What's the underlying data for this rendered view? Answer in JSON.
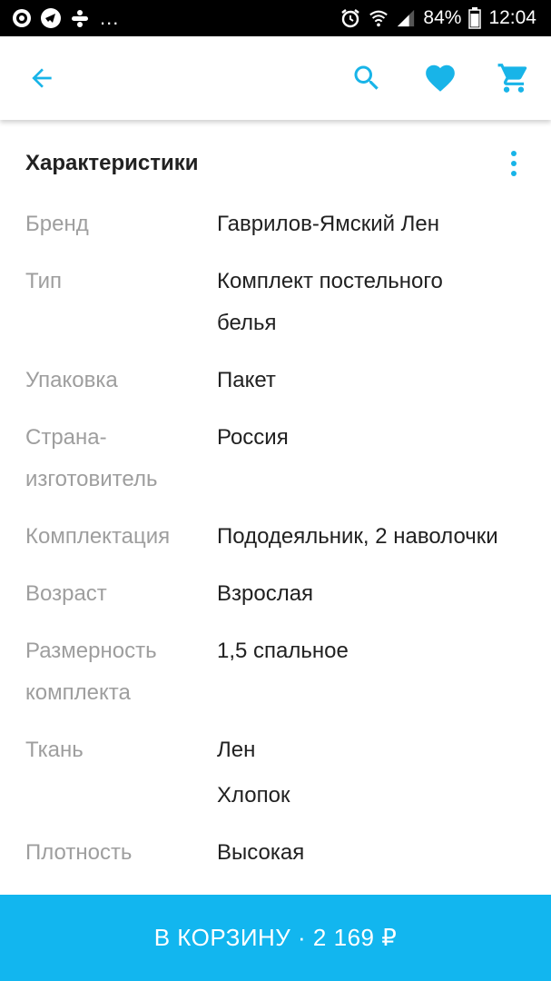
{
  "status": {
    "battery": "84%",
    "time": "12:04",
    "more": "..."
  },
  "colors": {
    "accent": "#18b4e8",
    "button": "#12b6ef"
  },
  "toolbar": {
    "icons": [
      "arrow-back-icon",
      "search-icon",
      "heart-icon",
      "shopping-cart-icon"
    ]
  },
  "section": {
    "title": "Характеристики"
  },
  "specs": [
    {
      "label": "Бренд",
      "values": [
        "Гаврилов-Ямский Лен"
      ]
    },
    {
      "label": "Тип",
      "values": [
        "Комплект постельного белья"
      ]
    },
    {
      "label": "Упаковка",
      "values": [
        "Пакет"
      ]
    },
    {
      "label": "Страна-изготовитель",
      "values": [
        "Россия"
      ]
    },
    {
      "label": "Комплектация",
      "values": [
        "Пододеяльник, 2 наволочки"
      ]
    },
    {
      "label": "Возраст",
      "values": [
        "Взрослая"
      ]
    },
    {
      "label": "Размерность комплекта",
      "values": [
        "1,5 спальное"
      ]
    },
    {
      "label": "Ткань",
      "values": [
        "Лен",
        "Хлопок"
      ]
    },
    {
      "label": "Плотность",
      "values": [
        "Высокая"
      ]
    }
  ],
  "cart_button": {
    "label": "В КОРЗИНУ · 2 169 ₽"
  }
}
